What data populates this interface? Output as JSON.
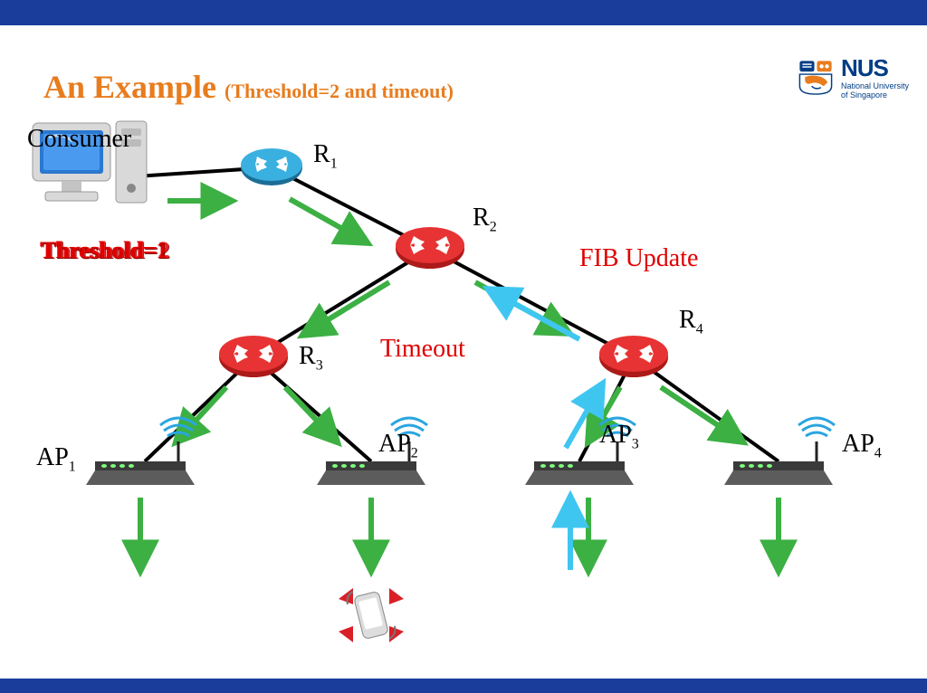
{
  "title_main": "An Example",
  "title_sub": "(Threshold=2 and timeout)",
  "logo": {
    "name": "NUS",
    "sub1": "National University",
    "sub2": "of Singapore"
  },
  "labels": {
    "consumer": "Consumer",
    "r1": "R",
    "r1sub": "1",
    "r2": "R",
    "r2sub": "2",
    "r3": "R",
    "r3sub": "3",
    "r4": "R",
    "r4sub": "4",
    "ap1": "AP",
    "ap1sub": "1",
    "ap2": "AP",
    "ap2sub": "2",
    "ap3": "AP",
    "ap3sub": "3",
    "ap4": "AP",
    "ap4sub": "4"
  },
  "annotations": {
    "threshold1": "Threshold=1",
    "threshold2": "Threshold=2",
    "timeout": "Timeout",
    "fib": "FIB Update"
  },
  "colors": {
    "band": "#1a3d9c",
    "title": "#e87c1e",
    "router_red": "#d92027",
    "router_blue": "#2aa5e0",
    "arrow_green": "#3cb043",
    "arrow_cyan": "#3fc6f0",
    "red_text": "#e00000"
  }
}
